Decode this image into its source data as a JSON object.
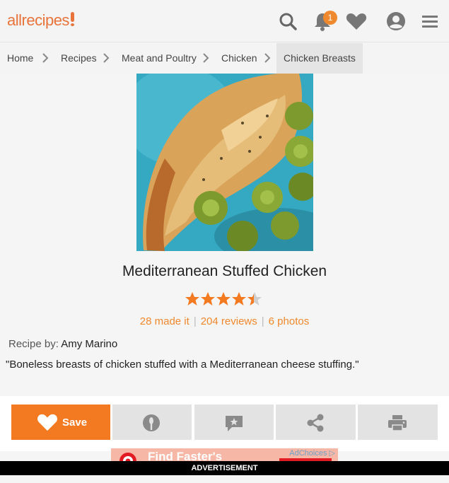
{
  "header": {
    "logo": "allrecipes",
    "notifications_count": "1",
    "icons": [
      "search-icon",
      "bell-icon",
      "heart-icon",
      "profile-icon",
      "menu-icon"
    ]
  },
  "breadcrumb": {
    "items": [
      "Home",
      "Recipes",
      "Meat and Poultry",
      "Chicken",
      "Chicken Breasts"
    ]
  },
  "recipe": {
    "title": "Mediterranean Stuffed Chicken",
    "rating": 4.5,
    "made_it": "28 made it",
    "reviews": "204 reviews",
    "photos": "6 photos",
    "separator": "|",
    "byline_label": "Recipe by:",
    "author": "Amy Marino",
    "description": "\"Boneless breasts of chicken stuffed with a Mediterranean cheese stuffing.\""
  },
  "actions": {
    "save_label": "Save",
    "icons": [
      "heart-icon",
      "made-it-icon",
      "review-icon",
      "share-icon",
      "print-icon"
    ]
  },
  "ad": {
    "text": "Find Faster's",
    "adchoices": "AdChoices",
    "label": "ADVERTISEMENT"
  },
  "colors": {
    "brand": "#f47a21",
    "star": "#f47a21"
  }
}
